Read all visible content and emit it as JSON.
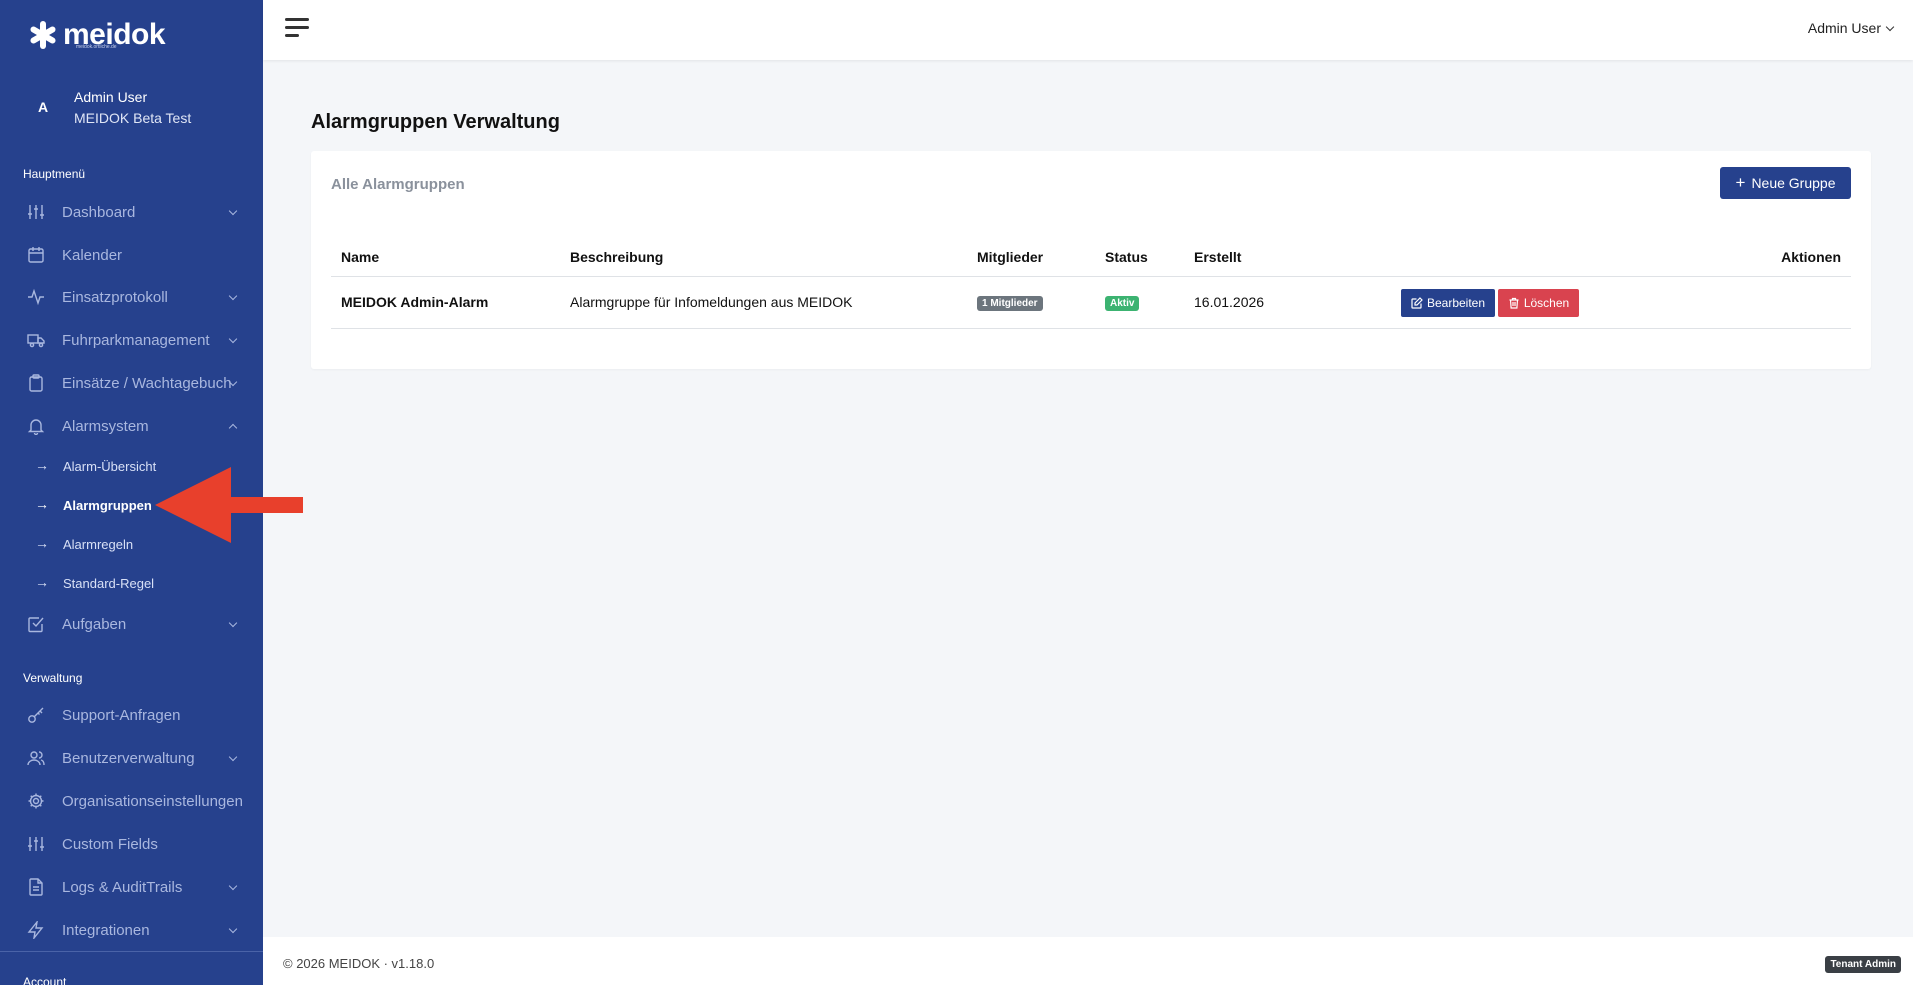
{
  "brand": {
    "name": "meidok",
    "tagline": "meidok.ortliche.de"
  },
  "user": {
    "initial": "A",
    "name": "Admin User",
    "org": "MEIDOK Beta Test"
  },
  "sidebar": {
    "main_label": "Hauptmenü",
    "items": [
      {
        "label": "Dashboard",
        "icon": "sliders-icon",
        "chevron": "down"
      },
      {
        "label": "Kalender",
        "icon": "calendar-icon",
        "chevron": ""
      },
      {
        "label": "Einsatzprotokoll",
        "icon": "activity-icon",
        "chevron": "down"
      },
      {
        "label": "Fuhrparkmanagement",
        "icon": "truck-icon",
        "chevron": "down"
      },
      {
        "label": "Einsätze / Wachtagebuch",
        "icon": "clipboard-icon",
        "chevron": "down"
      },
      {
        "label": "Alarmsystem",
        "icon": "bell-icon",
        "chevron": "up"
      }
    ],
    "alarm_sub": [
      {
        "label": "Alarm-Übersicht",
        "arrow": "→"
      },
      {
        "label": "Alarmgruppen",
        "arrow": "→",
        "active": true
      },
      {
        "label": "Alarmregeln",
        "arrow": "→"
      },
      {
        "label": "Standard-Regel",
        "arrow": "→"
      }
    ],
    "tasks": {
      "label": "Aufgaben",
      "icon": "check-square-icon"
    },
    "admin_label": "Verwaltung",
    "admin_items": [
      {
        "label": "Support-Anfragen",
        "icon": "key-icon"
      },
      {
        "label": "Benutzerverwaltung",
        "icon": "users-icon"
      },
      {
        "label": "Organisationseinstellungen",
        "icon": "gear-icon"
      },
      {
        "label": "Custom Fields",
        "icon": "sliders-icon"
      },
      {
        "label": "Logs & AuditTrails",
        "icon": "file-text-icon"
      },
      {
        "label": "Integrationen",
        "icon": "zap-icon"
      }
    ],
    "account_label": "Account"
  },
  "topbar": {
    "user_label": "Admin User"
  },
  "page": {
    "title_bold": "Alarmgruppen",
    "title_rest": "Verwaltung"
  },
  "card": {
    "title": "Alle Alarmgruppen",
    "new_button": "Neue Gruppe",
    "new_button_icon": "+",
    "columns": [
      "Name",
      "Beschreibung",
      "Mitglieder",
      "Status",
      "Erstellt",
      "Aktionen"
    ],
    "rows": [
      {
        "name": "MEIDOK Admin-Alarm",
        "description": "Alarmgruppe für Infomeldungen aus MEIDOK",
        "members": "1 Mitglieder",
        "status": "Aktiv",
        "created": "16.01.2026",
        "edit": "Bearbeiten",
        "delete": "Löschen"
      }
    ]
  },
  "footer": {
    "copyright": "© 2026 MEIDOK · v1.18.0",
    "role_badge": "Tenant Admin"
  },
  "colors": {
    "sidebar": "#26418d",
    "primary": "#26418d",
    "danger": "#d9434f",
    "success": "#3cb371",
    "annotation": "#e8402c"
  }
}
